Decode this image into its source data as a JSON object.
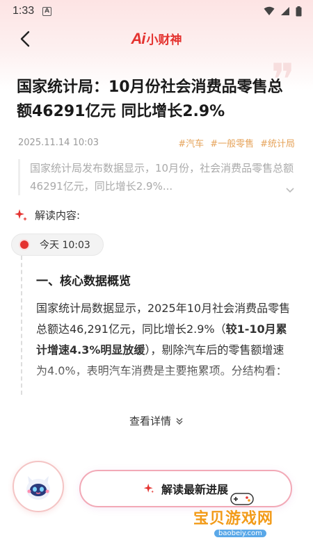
{
  "status_bar": {
    "time": "1:33",
    "icons": [
      "notification-a-icon",
      "wifi-icon",
      "signal-icon",
      "battery-icon"
    ]
  },
  "nav": {
    "brand_ai": "Ai",
    "brand_name": "小财神"
  },
  "article": {
    "title": "国家统计局：10月份社会消费品零售总额46291亿元 同比增长2.9%",
    "date": "2025.11.14 10:03",
    "tags": [
      "#汽车",
      "#一般零售",
      "#统计局"
    ],
    "summary": "国家统计局发布数据显示，10月份，社会消费品零售总额46291亿元，同比增长2.9%..."
  },
  "analysis": {
    "label": "解读内容:",
    "time": "今天 10:03",
    "heading": "一、核心数据概览",
    "text_part1": "国家统计局数据显示，2025年10月社会消费品零售总额达46,291亿元，同比增长2.9%（",
    "text_bold": "较1-10月累计增速4.3%明显放缓",
    "text_part2": "），剔除汽车后的零售额增速为4.0%，表明汽车消费是主要拖累项。分结构看：",
    "more_label": "查看详情"
  },
  "bottom": {
    "cta_label": "解读最新进展"
  },
  "watermark": {
    "text": "宝贝游戏网",
    "url": "baobeiy.com"
  },
  "colors": {
    "accent": "#e4322f",
    "tag": "#e6a35a",
    "muted": "#9a9a9a"
  }
}
